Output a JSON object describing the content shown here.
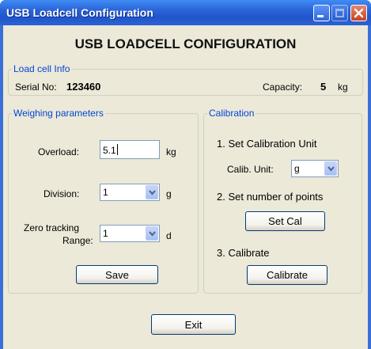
{
  "window": {
    "title": "USB Loadcell Configuration"
  },
  "heading": "USB LOADCELL CONFIGURATION",
  "load_cell_info": {
    "legend": "Load cell Info",
    "serial_label": "Serial No:",
    "serial_value": "123460",
    "capacity_label": "Capacity:",
    "capacity_value": "5",
    "capacity_unit": "kg"
  },
  "weighing": {
    "legend": "Weighing parameters",
    "overload_label": "Overload:",
    "overload_value": "5.1",
    "overload_unit": "kg",
    "division_label": "Division:",
    "division_value": "1",
    "division_unit": "g",
    "zero_label_line1": "Zero tracking",
    "zero_label_line2": "Range:",
    "zero_value": "1",
    "zero_unit": "d",
    "save_label": "Save"
  },
  "calibration": {
    "legend": "Calibration",
    "step1": "1. Set Calibration Unit",
    "unit_label": "Calib. Unit:",
    "unit_value": "g",
    "step2": "2. Set number of points",
    "setcal_label": "Set Cal",
    "step3": "3. Calibrate",
    "calibrate_label": "Calibrate"
  },
  "exit_label": "Exit",
  "icons": [
    "minimize-icon",
    "maximize-icon",
    "close-icon",
    "chevron-down-icon"
  ]
}
